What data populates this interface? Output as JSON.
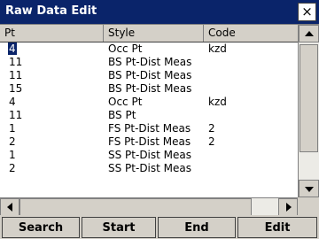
{
  "window": {
    "title": "Raw Data Edit",
    "close_label": "×"
  },
  "table": {
    "columns": [
      "Pt",
      "Style",
      "Code"
    ],
    "rows": [
      {
        "pt": "4",
        "style": "Occ Pt",
        "code": "kzd"
      },
      {
        "pt": "11",
        "style": "BS Pt-Dist Meas",
        "code": ""
      },
      {
        "pt": "11",
        "style": "BS Pt-Dist Meas",
        "code": ""
      },
      {
        "pt": "15",
        "style": "BS Pt-Dist Meas",
        "code": ""
      },
      {
        "pt": "4",
        "style": "Occ Pt",
        "code": "kzd"
      },
      {
        "pt": "11",
        "style": "BS Pt",
        "code": ""
      },
      {
        "pt": "1",
        "style": "FS Pt-Dist Meas",
        "code": "2"
      },
      {
        "pt": "2",
        "style": "FS Pt-Dist Meas",
        "code": "2"
      },
      {
        "pt": "1",
        "style": "SS Pt-Dist Meas",
        "code": ""
      },
      {
        "pt": "2",
        "style": "SS Pt-Dist Meas",
        "code": ""
      }
    ],
    "selected_row": 0
  },
  "buttons": {
    "search": "Search",
    "start": "Start",
    "end": "End",
    "edit": "Edit"
  },
  "icons": {
    "close": "close-icon",
    "scroll_up": "arrow-up-icon",
    "scroll_down": "arrow-down-icon",
    "scroll_left": "arrow-left-icon",
    "scroll_right": "arrow-right-icon"
  },
  "colors": {
    "titlebar": "#0a246a",
    "selection": "#0a246a",
    "face": "#d4d0c8"
  }
}
